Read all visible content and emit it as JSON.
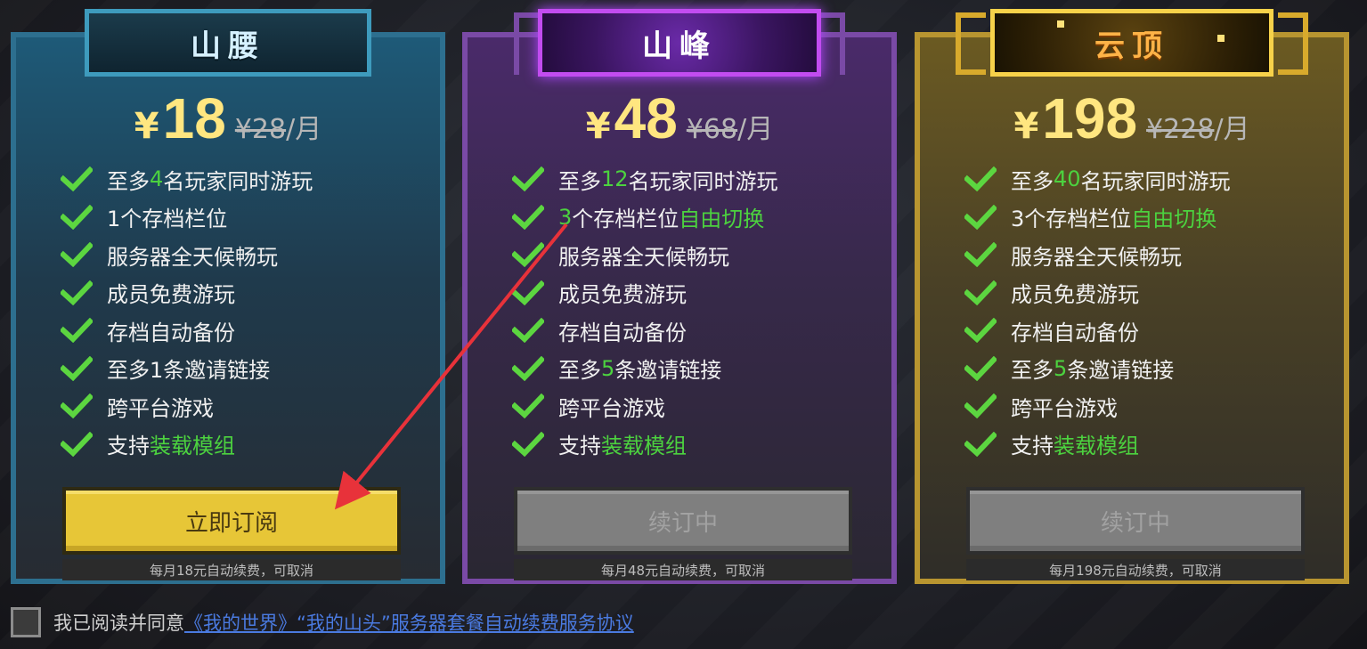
{
  "tiers": [
    {
      "name": "山腰",
      "currency": "¥",
      "price": "18",
      "original_price": "¥28",
      "period": "/月",
      "features": [
        {
          "parts": [
            {
              "t": "至多",
              "hl": false
            },
            {
              "t": "4",
              "hl": true
            },
            {
              "t": "名玩家同时游玩",
              "hl": false
            }
          ]
        },
        {
          "parts": [
            {
              "t": "1个存档栏位",
              "hl": false
            }
          ]
        },
        {
          "parts": [
            {
              "t": "服务器全天候畅玩",
              "hl": false
            }
          ]
        },
        {
          "parts": [
            {
              "t": "成员免费游玩",
              "hl": false
            }
          ]
        },
        {
          "parts": [
            {
              "t": "存档自动备份",
              "hl": false
            }
          ]
        },
        {
          "parts": [
            {
              "t": "至多1条邀请链接",
              "hl": false
            }
          ]
        },
        {
          "parts": [
            {
              "t": "跨平台游戏",
              "hl": false
            }
          ]
        },
        {
          "parts": [
            {
              "t": "支持",
              "hl": false
            },
            {
              "t": "装载模组",
              "hl": true
            }
          ]
        }
      ],
      "button": "立即订阅",
      "button_state": "active",
      "note": "每月18元自动续费，可取消"
    },
    {
      "name": "山峰",
      "currency": "¥",
      "price": "48",
      "original_price": "¥68",
      "period": "/月",
      "features": [
        {
          "parts": [
            {
              "t": "至多",
              "hl": false
            },
            {
              "t": "12",
              "hl": true
            },
            {
              "t": "名玩家同时游玩",
              "hl": false
            }
          ]
        },
        {
          "parts": [
            {
              "t": "3",
              "hl": true
            },
            {
              "t": "个存档栏位",
              "hl": false
            },
            {
              "t": "自由切换",
              "hl": true
            }
          ]
        },
        {
          "parts": [
            {
              "t": "服务器全天候畅玩",
              "hl": false
            }
          ]
        },
        {
          "parts": [
            {
              "t": "成员免费游玩",
              "hl": false
            }
          ]
        },
        {
          "parts": [
            {
              "t": "存档自动备份",
              "hl": false
            }
          ]
        },
        {
          "parts": [
            {
              "t": "至多",
              "hl": false
            },
            {
              "t": "5",
              "hl": true
            },
            {
              "t": "条邀请链接",
              "hl": false
            }
          ]
        },
        {
          "parts": [
            {
              "t": "跨平台游戏",
              "hl": false
            }
          ]
        },
        {
          "parts": [
            {
              "t": "支持",
              "hl": false
            },
            {
              "t": "装载模组",
              "hl": true
            }
          ]
        }
      ],
      "button": "续订中",
      "button_state": "disabled",
      "note": "每月48元自动续费，可取消"
    },
    {
      "name": "云顶",
      "currency": "¥",
      "price": "198",
      "original_price": "¥228",
      "period": "/月",
      "features": [
        {
          "parts": [
            {
              "t": "至多",
              "hl": false
            },
            {
              "t": "40",
              "hl": true
            },
            {
              "t": "名玩家同时游玩",
              "hl": false
            }
          ]
        },
        {
          "parts": [
            {
              "t": "3个存档栏位",
              "hl": false
            },
            {
              "t": "自由切换",
              "hl": true
            }
          ]
        },
        {
          "parts": [
            {
              "t": "服务器全天候畅玩",
              "hl": false
            }
          ]
        },
        {
          "parts": [
            {
              "t": "成员免费游玩",
              "hl": false
            }
          ]
        },
        {
          "parts": [
            {
              "t": "存档自动备份",
              "hl": false
            }
          ]
        },
        {
          "parts": [
            {
              "t": "至多",
              "hl": false
            },
            {
              "t": "5",
              "hl": true
            },
            {
              "t": "条邀请链接",
              "hl": false
            }
          ]
        },
        {
          "parts": [
            {
              "t": "跨平台游戏",
              "hl": false
            }
          ]
        },
        {
          "parts": [
            {
              "t": "支持",
              "hl": false
            },
            {
              "t": "装载模组",
              "hl": true
            }
          ]
        }
      ],
      "button": "续订中",
      "button_state": "disabled",
      "note": "每月198元自动续费，可取消"
    }
  ],
  "agreement": {
    "checked": false,
    "label": "我已阅读并同意",
    "link": "《我的世界》“我的山头”服务器套餐自动续费服务协议"
  },
  "colors": {
    "highlight": "#4cd23f",
    "price": "#ffe680",
    "arrow": "#e8323a"
  },
  "icons": {
    "feature_check": "check-icon"
  }
}
